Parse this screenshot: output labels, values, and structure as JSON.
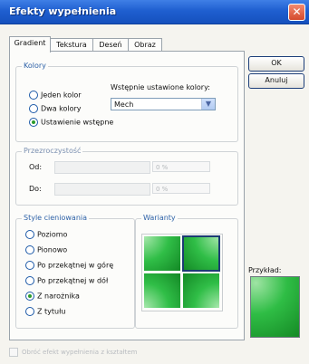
{
  "window": {
    "title": "Efekty wypełnienia",
    "close_glyph": "✕"
  },
  "tabs": [
    {
      "label": "Gradient",
      "active": true
    },
    {
      "label": "Tekstura",
      "active": false
    },
    {
      "label": "Deseń",
      "active": false
    },
    {
      "label": "Obraz",
      "active": false
    }
  ],
  "colors_group": {
    "legend": "Kolory",
    "options": [
      {
        "label": "Jeden kolor",
        "selected": false
      },
      {
        "label": "Dwa kolory",
        "selected": false
      },
      {
        "label": "Ustawienie wstępne",
        "selected": true
      }
    ],
    "preset_label": "Wstępnie ustawione kolory:",
    "preset_value": "Mech"
  },
  "transparency_group": {
    "legend": "Przezroczystość",
    "from_label": "Od:",
    "to_label": "Do:",
    "from_value": "0 %",
    "to_value": "0 %"
  },
  "shading_group": {
    "legend": "Style cieniowania",
    "options": [
      {
        "label": "Poziomo",
        "selected": false
      },
      {
        "label": "Pionowo",
        "selected": false
      },
      {
        "label": "Po przekątnej w górę",
        "selected": false
      },
      {
        "label": "Po przekątnej w dół",
        "selected": false
      },
      {
        "label": "Z narożnika",
        "selected": true
      },
      {
        "label": "Z tytułu",
        "selected": false
      }
    ]
  },
  "variants_group": {
    "legend": "Warianty"
  },
  "buttons": {
    "ok": "OK",
    "cancel": "Anuluj"
  },
  "sample_label": "Przykład:",
  "footer": {
    "rotate_label": "Obróć efekt wypełnienia z kształtem"
  },
  "colors": {
    "green_light": "#9fe4a4",
    "green_mid": "#2fbd45",
    "green_dark": "#158a25",
    "title_blue": "#1f5fd0"
  }
}
